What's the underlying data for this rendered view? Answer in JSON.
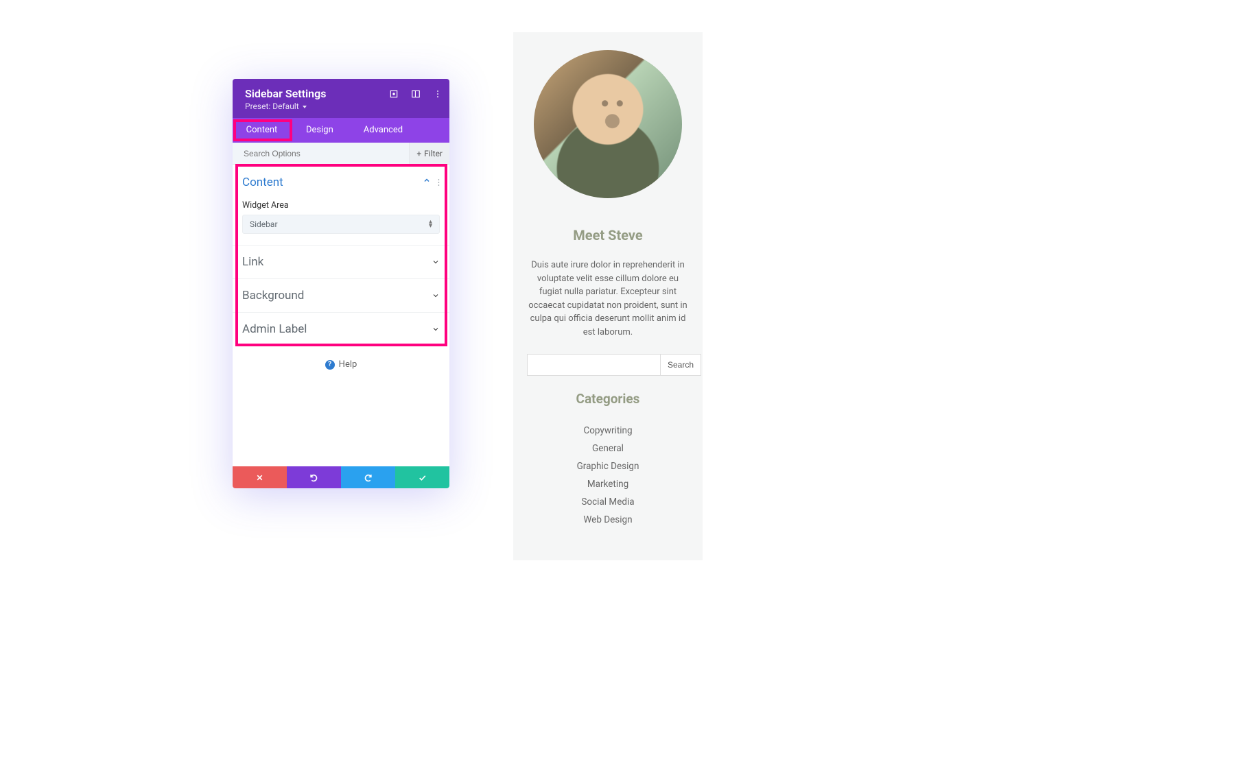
{
  "settings": {
    "title": "Sidebar Settings",
    "preset_label": "Preset: Default",
    "tabs": {
      "content": "Content",
      "design": "Design",
      "advanced": "Advanced"
    },
    "search_placeholder": "Search Options",
    "filter_label": "Filter",
    "sections": {
      "content_title": "Content",
      "widget_area_label": "Widget Area",
      "widget_area_value": "Sidebar",
      "link_title": "Link",
      "background_title": "Background",
      "admin_label_title": "Admin Label"
    },
    "help_label": "Help"
  },
  "preview": {
    "title": "Meet Steve",
    "description": "Duis aute irure dolor in reprehenderit in voluptate velit esse cillum dolore eu fugiat nulla pariatur. Excepteur sint occaecat cupidatat non proident, sunt in culpa qui officia deserunt mollit anim id est laborum.",
    "search_button": "Search",
    "categories_title": "Categories",
    "categories": [
      "Copywriting",
      "General",
      "Graphic Design",
      "Marketing",
      "Social Media",
      "Web Design"
    ]
  }
}
